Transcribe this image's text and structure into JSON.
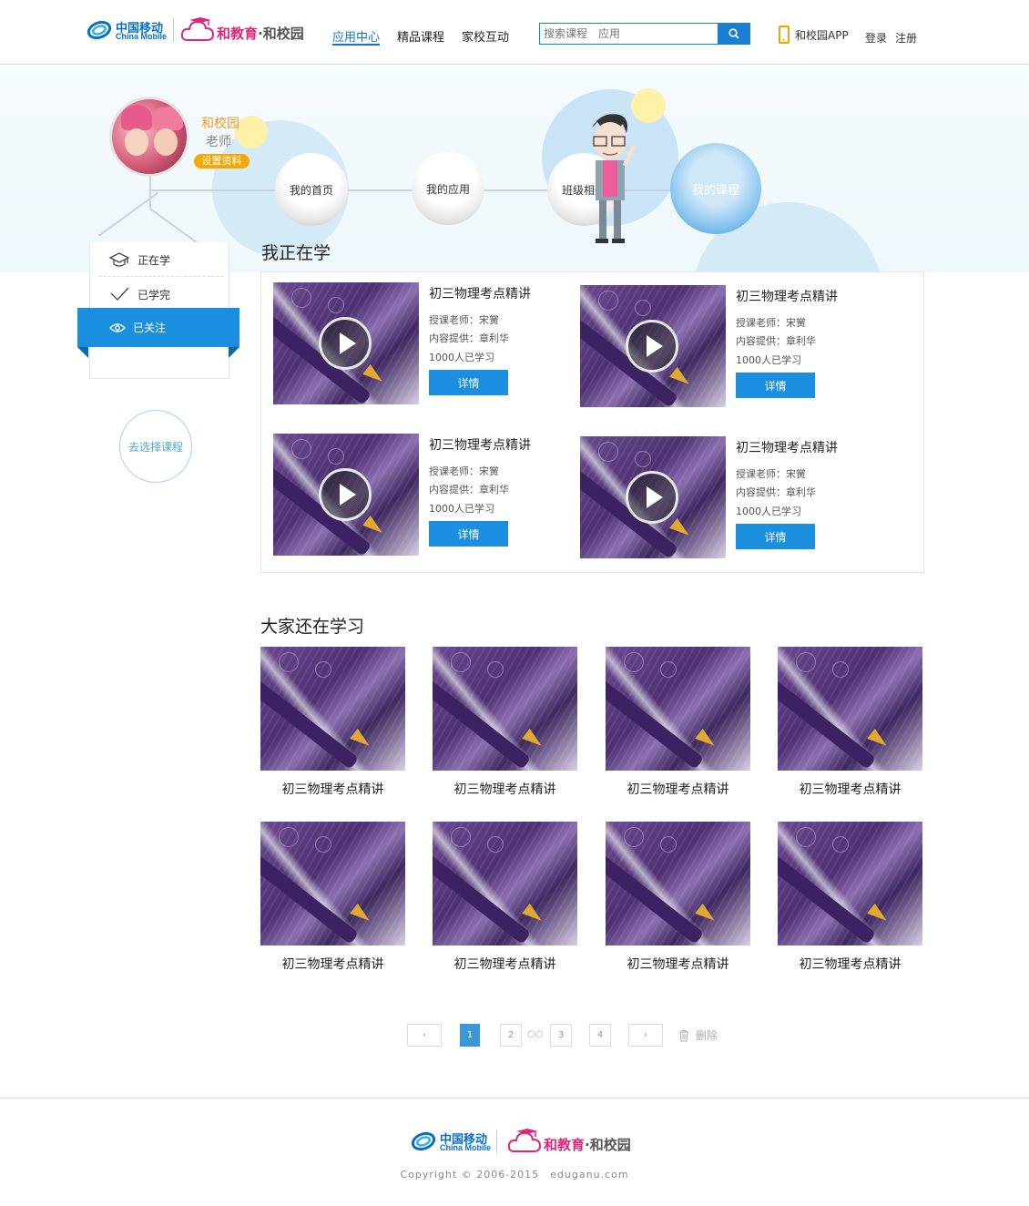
{
  "header": {
    "china_mobile_cn": "中国移动",
    "china_mobile_en": "China Mobile",
    "brand_main": "和教育",
    "brand_sub": "·和校园",
    "nav": [
      {
        "label": "应用中心",
        "active": true
      },
      {
        "label": "精品课程",
        "active": false
      },
      {
        "label": "家校互动",
        "active": false
      }
    ],
    "search_placeholder": "搜索课程　应用",
    "search_icon": "search-icon",
    "app_label": "和校园APP",
    "login": "登录",
    "register": "注册"
  },
  "profile": {
    "name": "和校园",
    "role": "老师",
    "settings": "设置资料"
  },
  "circle_nav": [
    {
      "label": "我的首页",
      "active": false
    },
    {
      "label": "我的应用",
      "active": false
    },
    {
      "label": "班级相册",
      "active": false
    },
    {
      "label": "我的课程",
      "active": true
    }
  ],
  "side_menu": {
    "items": [
      {
        "label": "正在学",
        "icon": "graduation-cap-icon"
      },
      {
        "label": "已学完",
        "icon": "check-icon"
      },
      {
        "label": "已关注",
        "icon": "eye-icon",
        "active": true
      }
    ],
    "choose_course": "去选择课程"
  },
  "learning": {
    "title": "我正在学",
    "courses": [
      {
        "title": "初三物理考点精讲",
        "teacher": "授课老师：宋黉",
        "provider": "内容提供：章利华",
        "learners": "1000人已学习",
        "button": "详情"
      },
      {
        "title": "初三物理考点精讲",
        "teacher": "授课老师：宋黉",
        "provider": "内容提供：章利华",
        "learners": "1000人已学习",
        "button": "详情"
      },
      {
        "title": "初三物理考点精讲",
        "teacher": "授课老师：宋黉",
        "provider": "内容提供：章利华",
        "learners": "1000人已学习",
        "button": "详情"
      },
      {
        "title": "初三物理考点精讲",
        "teacher": "授课老师：宋黉",
        "provider": "内容提供：章利华",
        "learners": "1000人已学习",
        "button": "详情"
      }
    ]
  },
  "others": {
    "title": "大家还在学习",
    "courses": [
      {
        "title": "初三物理考点精讲"
      },
      {
        "title": "初三物理考点精讲"
      },
      {
        "title": "初三物理考点精讲"
      },
      {
        "title": "初三物理考点精讲"
      },
      {
        "title": "初三物理考点精讲"
      },
      {
        "title": "初三物理考点精讲"
      },
      {
        "title": "初三物理考点精讲"
      },
      {
        "title": "初三物理考点精讲"
      }
    ]
  },
  "pagination": {
    "prev": "‹",
    "pages": [
      "1",
      "2",
      "3",
      "4"
    ],
    "current": "1",
    "dots": "○○",
    "next": "›",
    "delete": "删除"
  },
  "footer": {
    "copyright": "Copyright © 2006-2015　eduganu.com"
  },
  "colors": {
    "accent": "#1a8fe0",
    "orange": "#f5a800",
    "brand_pink": "#e0257a",
    "china_mobile_blue": "#0a6fc2"
  }
}
